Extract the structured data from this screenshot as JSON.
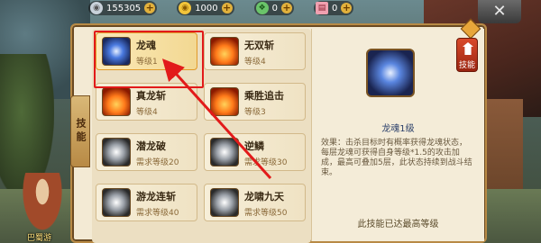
{
  "top_bar": {
    "silver": "155305",
    "gold": "1000",
    "jade": "0",
    "ticket": "0"
  },
  "panel": {
    "side_tab_label": "技能",
    "right_tab_label": "技能"
  },
  "skills": [
    {
      "name": "龙魂",
      "level": "等级1",
      "icon": "blue-sword-icon",
      "selected": true
    },
    {
      "name": "无双斩",
      "level": "等级4",
      "icon": "fire-slash-icon"
    },
    {
      "name": "真龙斩",
      "level": "等级4",
      "icon": "fire-dragon-icon"
    },
    {
      "name": "乘胜追击",
      "level": "等级3",
      "icon": "fire-burst-icon"
    },
    {
      "name": "潜龙破",
      "level": "需求等级20",
      "icon": "white-swirl-icon"
    },
    {
      "name": "逆鳞",
      "level": "需求等级30",
      "icon": "white-scale-icon"
    },
    {
      "name": "游龙连斩",
      "level": "需求等级40",
      "icon": "white-slash-icon"
    },
    {
      "name": "龙啸九天",
      "level": "需求等级50",
      "icon": "white-roar-icon"
    }
  ],
  "detail": {
    "title": "龙魂1级",
    "description": "效果：击杀目标时有概率获得龙魂状态，每层龙魂可获得自身等级*1.5的攻击加成，最高可叠加5层，此状态持续到战斗结束。",
    "max_text": "此技能已达最高等级"
  },
  "npc": {
    "name": "巴蜀游"
  },
  "colors": {
    "highlight_box": "#e21a1a",
    "arrow": "#e21a1a"
  }
}
